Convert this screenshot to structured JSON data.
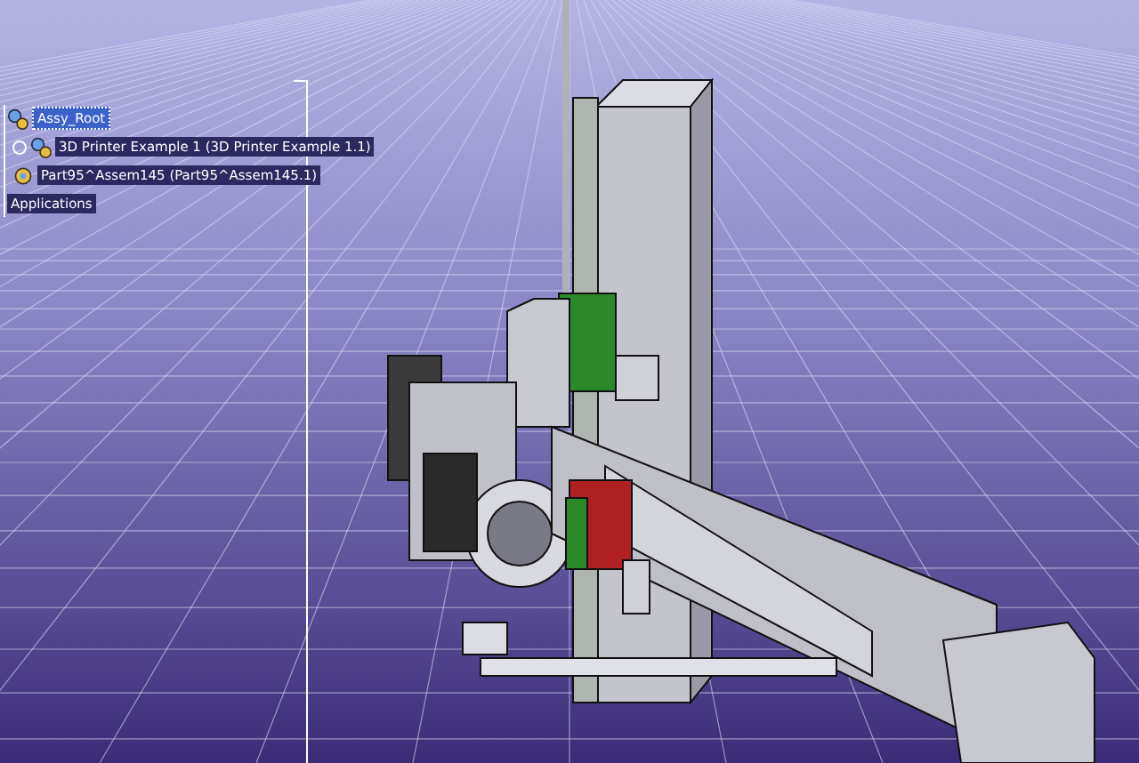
{
  "tree": {
    "root": {
      "label": "Assy_Root",
      "kind": "product",
      "selected": true,
      "children": [
        {
          "label": "3D Printer Example 1 (3D Printer Example 1.1)",
          "kind": "product",
          "selected": false,
          "expanded": false
        },
        {
          "label": "Part95^Assem145 (Part95^Assem145.1)",
          "kind": "part",
          "selected": false
        },
        {
          "label": "Applications",
          "kind": "node",
          "selected": false
        }
      ]
    }
  }
}
